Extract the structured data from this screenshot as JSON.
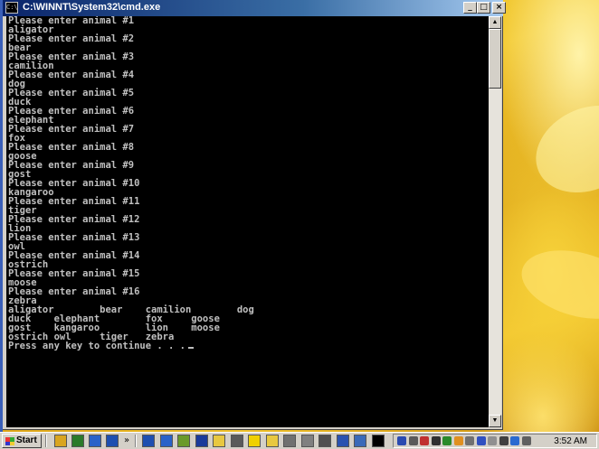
{
  "window": {
    "title": "C:\\WINNT\\System32\\cmd.exe",
    "icon_label": "C:\\",
    "min_glyph": "_",
    "max_glyph": "□",
    "close_glyph": "×"
  },
  "console": {
    "lines": [
      "Please enter animal #1",
      "aligator",
      "Please enter animal #2",
      "bear",
      "Please enter animal #3",
      "camilion",
      "Please enter animal #4",
      "dog",
      "Please enter animal #5",
      "duck",
      "Please enter animal #6",
      "elephant",
      "Please enter animal #7",
      "fox",
      "Please enter animal #8",
      "goose",
      "Please enter animal #9",
      "gost",
      "Please enter animal #10",
      "kangaroo",
      "Please enter animal #11",
      "tiger",
      "Please enter animal #12",
      "lion",
      "Please enter animal #13",
      "owl",
      "Please enter animal #14",
      "ostrich",
      "Please enter animal #15",
      "moose",
      "Please enter animal #16",
      "zebra",
      "aligator        bear    camilion        dog",
      "duck    elephant        fox     goose",
      "gost    kangaroo        lion    moose",
      "ostrich owl     tiger   zebra",
      "Press any key to continue . . ."
    ],
    "text_color": "#c0c0c0",
    "background": "#000000"
  },
  "scrollbar": {
    "up_glyph": "▲",
    "down_glyph": "▼"
  },
  "taskbar": {
    "start_label": "Start",
    "chevron": "»",
    "clock": "3:52 AM"
  },
  "quicklaunch_icons": [
    {
      "name": "show-desktop-icon",
      "color": "#d9a520"
    },
    {
      "name": "browser-icon",
      "color": "#2a7a2a"
    },
    {
      "name": "internet-explorer-icon",
      "color": "#2a62c8"
    },
    {
      "name": "outlook-icon",
      "color": "#1e4fb0"
    }
  ],
  "task_icons": [
    {
      "name": "app-icon-1",
      "color": "#1e4fb0"
    },
    {
      "name": "app-icon-2",
      "color": "#2a62c8"
    },
    {
      "name": "app-icon-3",
      "color": "#6a9a2a"
    },
    {
      "name": "app-icon-4",
      "color": "#1a3a9a"
    },
    {
      "name": "folder-icon",
      "color": "#e8c840"
    },
    {
      "name": "app-icon-5",
      "color": "#5a5a5a"
    },
    {
      "name": "app-icon-6",
      "color": "#f0d000"
    },
    {
      "name": "app-icon-7",
      "color": "#e8c840"
    },
    {
      "name": "app-icon-8",
      "color": "#707070"
    },
    {
      "name": "app-icon-9",
      "color": "#808080"
    },
    {
      "name": "app-icon-10",
      "color": "#505050"
    },
    {
      "name": "word-icon",
      "color": "#2a52b0"
    },
    {
      "name": "app-icon-11",
      "color": "#3a6ab8"
    },
    {
      "name": "cmd-icon",
      "color": "#000000"
    }
  ],
  "tray_icons": [
    {
      "name": "network-icon",
      "color": "#2a4ab0"
    },
    {
      "name": "volume-icon",
      "color": "#5a5a5a"
    },
    {
      "name": "tray-icon-3",
      "color": "#c03030"
    },
    {
      "name": "tray-icon-4",
      "color": "#303030"
    },
    {
      "name": "tray-icon-5",
      "color": "#2a8a2a"
    },
    {
      "name": "tray-icon-6",
      "color": "#e09020"
    },
    {
      "name": "tray-icon-7",
      "color": "#707070"
    },
    {
      "name": "tray-icon-8",
      "color": "#3050c0"
    },
    {
      "name": "tray-icon-9",
      "color": "#909090"
    },
    {
      "name": "tray-icon-10",
      "color": "#404040"
    },
    {
      "name": "tray-icon-11",
      "color": "#2a6ad0"
    },
    {
      "name": "tray-icon-12",
      "color": "#606060"
    }
  ]
}
